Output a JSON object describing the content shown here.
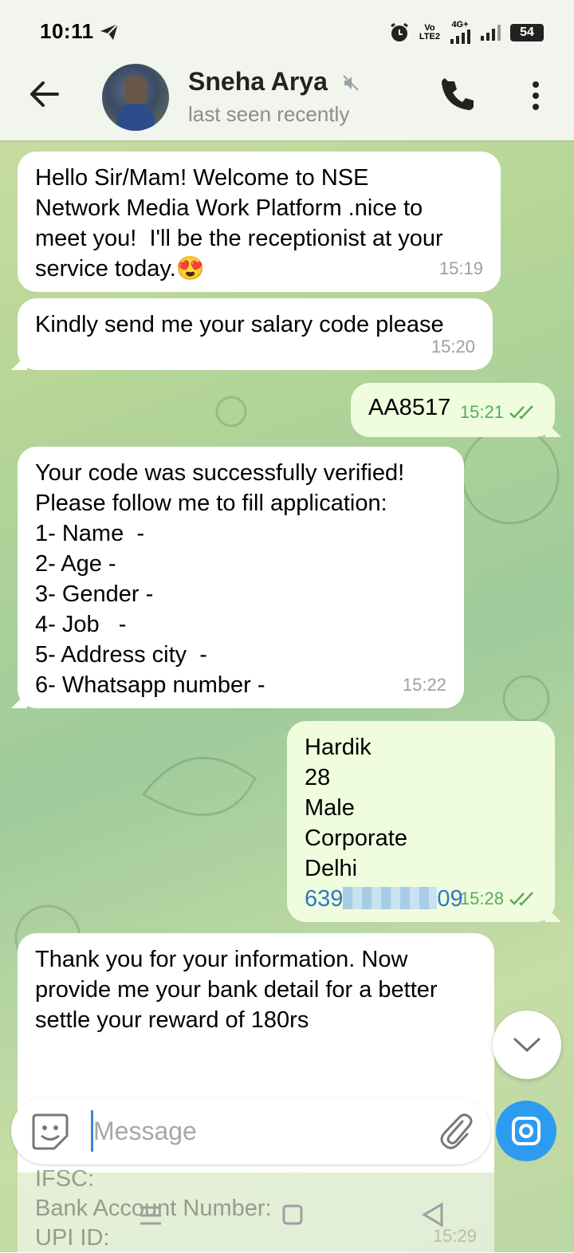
{
  "status_bar": {
    "time": "10:11",
    "net_label_1": "Vo",
    "net_label_2": "LTE2",
    "net_label_3": "4G+",
    "battery": "54"
  },
  "header": {
    "contact_name": "Sneha Arya",
    "status": "last seen recently"
  },
  "messages": [
    {
      "dir": "in",
      "lines": [
        "Hello Sir/Mam! Welcome to NSE",
        "Network Media Work Platform .nice to",
        "meet you!  I'll be the receptionist at your",
        "service today.😍"
      ],
      "time": "15:19"
    },
    {
      "dir": "in",
      "lines": [
        "Kindly send me your salary code please"
      ],
      "time": "15:20"
    },
    {
      "dir": "out",
      "lines": [
        "AA8517"
      ],
      "time": "15:21"
    },
    {
      "dir": "in",
      "lines": [
        "Your code was successfully verified!",
        "Please follow me to fill application:",
        "1- Name  -",
        "2- Age -",
        "3- Gender -",
        "4- Job   -",
        "5- Address city  -",
        "6- Whatsapp number -"
      ],
      "time": "15:22"
    },
    {
      "dir": "out",
      "lines": [
        "Hardik",
        "28",
        "Male",
        "Corporate",
        "Delhi"
      ],
      "phone_start": "639",
      "phone_end": "09",
      "time": "15:28"
    },
    {
      "dir": "in",
      "lines": [
        "Thank you for your information. Now",
        "provide me your bank detail for a better",
        "settle your reward of 180rs"
      ]
    }
  ],
  "faded_lines": [
    "IFSC:",
    "Bank Account Number:",
    "UPI ID:"
  ],
  "faded_time": "15:29",
  "composer": {
    "placeholder": "Message"
  },
  "icons": {
    "back": "back-arrow-icon",
    "mute": "muted-icon",
    "call": "phone-icon",
    "menu": "more-vert-icon",
    "sticker": "sticker-icon",
    "attach": "paperclip-icon",
    "camera": "camera-icon",
    "scroll": "chevron-down-icon"
  },
  "colors": {
    "incoming_bubble": "#ffffff",
    "outgoing_bubble": "#effdde",
    "read_ticks": "#5aaa5a",
    "camera_button": "#2d9bf0",
    "link": "#2f78c4"
  }
}
